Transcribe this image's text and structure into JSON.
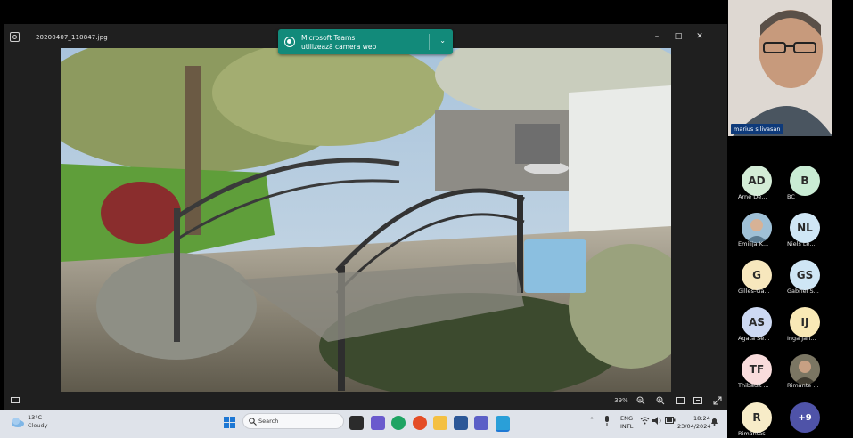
{
  "viewer": {
    "file_name": "20200407_110847.jpg",
    "zoom": "39%",
    "window_buttons": {
      "minimize": "–",
      "maximize": "□",
      "close": "✕"
    }
  },
  "toast": {
    "app": "Microsoft Teams",
    "message": "utilizează camera web",
    "chevron": "⌄"
  },
  "taskbar": {
    "weather": {
      "temp": "13°C",
      "condition": "Cloudy"
    },
    "search_placeholder": "Search",
    "language": {
      "line1": "ENG",
      "line2": "INTL"
    },
    "time": "18:24",
    "date": "23/04/2024"
  },
  "self_view": {
    "name": "marius silivasan"
  },
  "participants": [
    {
      "initials": "AD",
      "name": "Arne De...",
      "color": "#d3ecd6"
    },
    {
      "initials": "B",
      "name": "BC",
      "color": "#c9ecd4"
    },
    {
      "initials": "",
      "name": "Emilija K...",
      "color": "#8fb0c8"
    },
    {
      "initials": "NL",
      "name": "Niels Le...",
      "color": "#cfe6f5"
    },
    {
      "initials": "G",
      "name": "Gilles-Ga...",
      "color": "#f7e7bd"
    },
    {
      "initials": "GS",
      "name": "Gabriel S...",
      "color": "#cfe6f5"
    },
    {
      "initials": "AS",
      "name": "Agata Se...",
      "color": "#cdd9f3"
    },
    {
      "initials": "IJ",
      "name": "Inga Jan...",
      "color": "#f9e9b6"
    },
    {
      "initials": "TF",
      "name": "Thibault ...",
      "color": "#f9dcdc"
    },
    {
      "initials": "",
      "name": "Rimante ...",
      "color": "#6d6a5a"
    },
    {
      "initials": "R",
      "name": "Rimantas",
      "color": "#f7ecc8"
    },
    {
      "initials": "+9",
      "name": "",
      "color": "#4f53a8"
    }
  ],
  "colors": {
    "teams_toast": "#128a7a",
    "self_name_badge": "#0e3a7a",
    "overflow_badge": "#4f53a8"
  }
}
